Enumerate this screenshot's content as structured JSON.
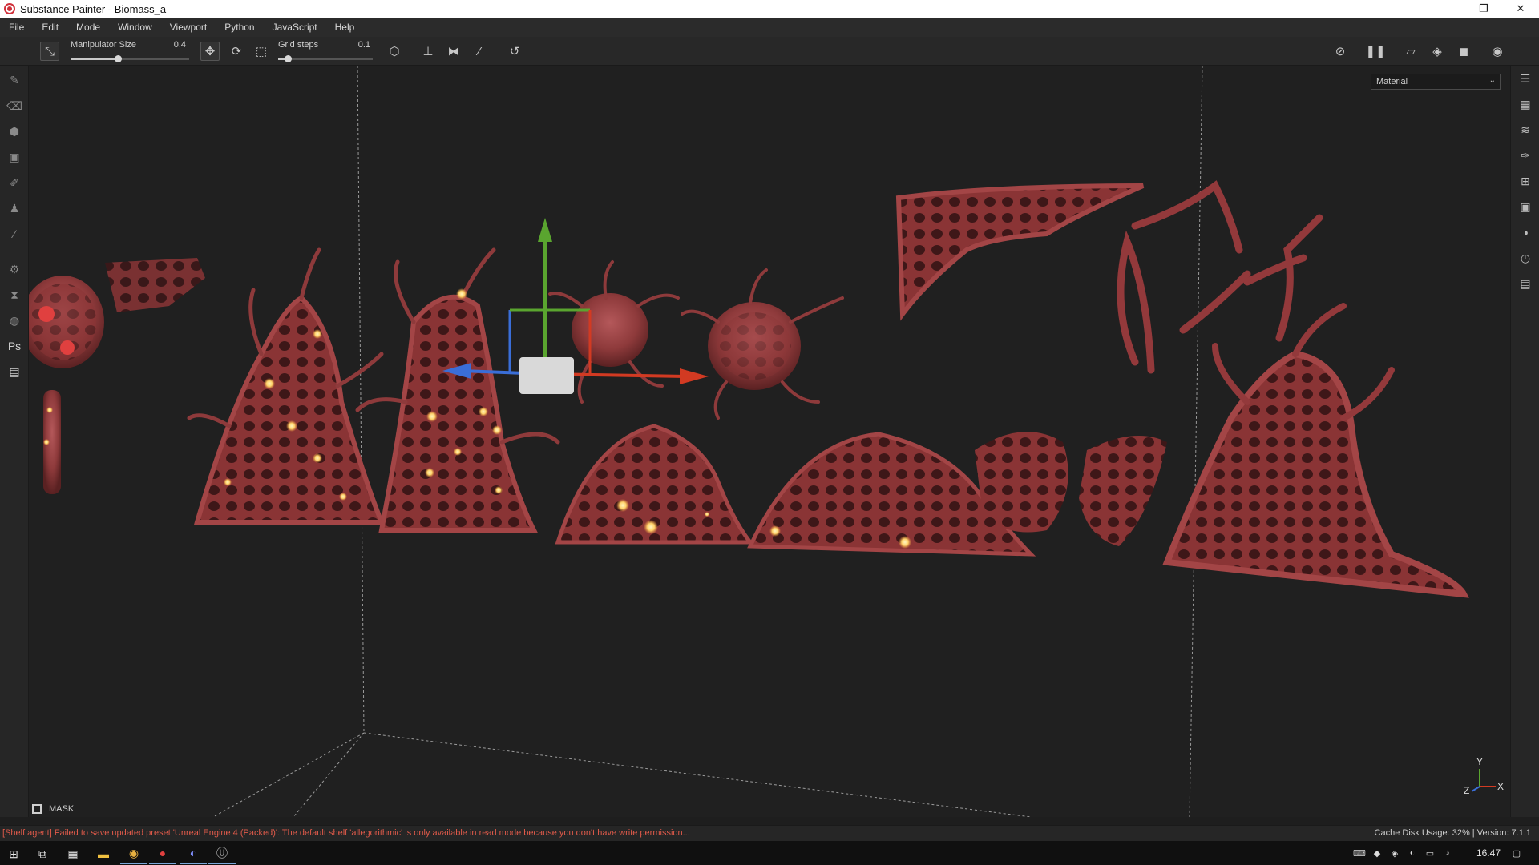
{
  "window": {
    "title": "Substance Painter - Biomass_a",
    "minimize": "—",
    "restore": "❐",
    "close": "✕"
  },
  "menu": [
    "File",
    "Edit",
    "Mode",
    "Window",
    "Viewport",
    "Python",
    "JavaScript",
    "Help"
  ],
  "toolbar": {
    "manipulator_label": "Manipulator Size",
    "manipulator_value": "0.4",
    "manipulator_fraction": 0.4,
    "grid_label": "Grid steps",
    "grid_value": "0.1",
    "grid_fraction": 0.1,
    "icons": [
      "transform-icon",
      "move-icon",
      "rotate-icon",
      "scale-icon",
      "cube-icon",
      "snap-icon",
      "mirror-icon",
      "slash-icon",
      "reset-icon"
    ],
    "right_icons": [
      "hide-icon",
      "pause-icon",
      "frame-icon",
      "cube-view-icon",
      "camera-icon",
      "screenshot-icon"
    ]
  },
  "viewport": {
    "channel": "Material",
    "mask_label": "MASK",
    "axes": {
      "x": "X",
      "y": "Y",
      "z": "Z"
    }
  },
  "status": {
    "message": "[Shelf agent] Failed to save updated preset 'Unreal Engine 4 (Packed)': The default shelf 'allegorithmic' is only available in read mode because you don't have write permission...",
    "right": "Cache Disk Usage:    32% | Version: 7.1.1"
  },
  "taskbar": {
    "clock": "16.47",
    "apps": [
      "start-icon",
      "task-view-icon",
      "calculator-icon",
      "explorer-icon",
      "chrome-icon",
      "substance-icon",
      "discord-icon",
      "unreal-icon"
    ]
  },
  "colors": {
    "accent_red": "#e05a4a",
    "biomass": "#8e3a3b",
    "glow": "#ffd36b",
    "axis_x": "#d23a22",
    "axis_y": "#5aa52f",
    "axis_z": "#3a6ed8"
  }
}
